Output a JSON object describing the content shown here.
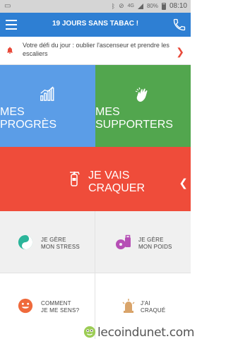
{
  "statusbar": {
    "network_type": "4G",
    "battery_percent": "80%",
    "time": "08:10"
  },
  "appbar": {
    "title": "19 JOURS SANS TABAC !"
  },
  "challenge": {
    "text": "Votre défi du jour : oublier l'ascenseur et prendre les escaliers"
  },
  "tiles": {
    "progres": {
      "line1": "MES",
      "line2": "PROGRÈS",
      "color": "#5b9de7"
    },
    "supporters": {
      "line1": "MES",
      "line2": "SUPPORTERS",
      "color": "#52a64e"
    },
    "craquer": {
      "line1": "JE VAIS",
      "line2": "CRAQUER",
      "color": "#ef4c3a"
    }
  },
  "actions": {
    "stress": {
      "line1": "JE GÈRE",
      "line2": "MON STRESS",
      "accent": "#2bb59a"
    },
    "poids": {
      "line1": "JE GÈRE",
      "line2": "MON POIDS",
      "accent": "#b64fb5"
    },
    "sens": {
      "line1": "COMMENT",
      "line2": "JE ME SENS?",
      "accent": "#ef6a3c"
    },
    "craque": {
      "line1": "J'AI",
      "line2": "CRAQUÉ",
      "accent": "#d9a46a"
    }
  },
  "watermark": {
    "text": "lecoindunet.com"
  }
}
